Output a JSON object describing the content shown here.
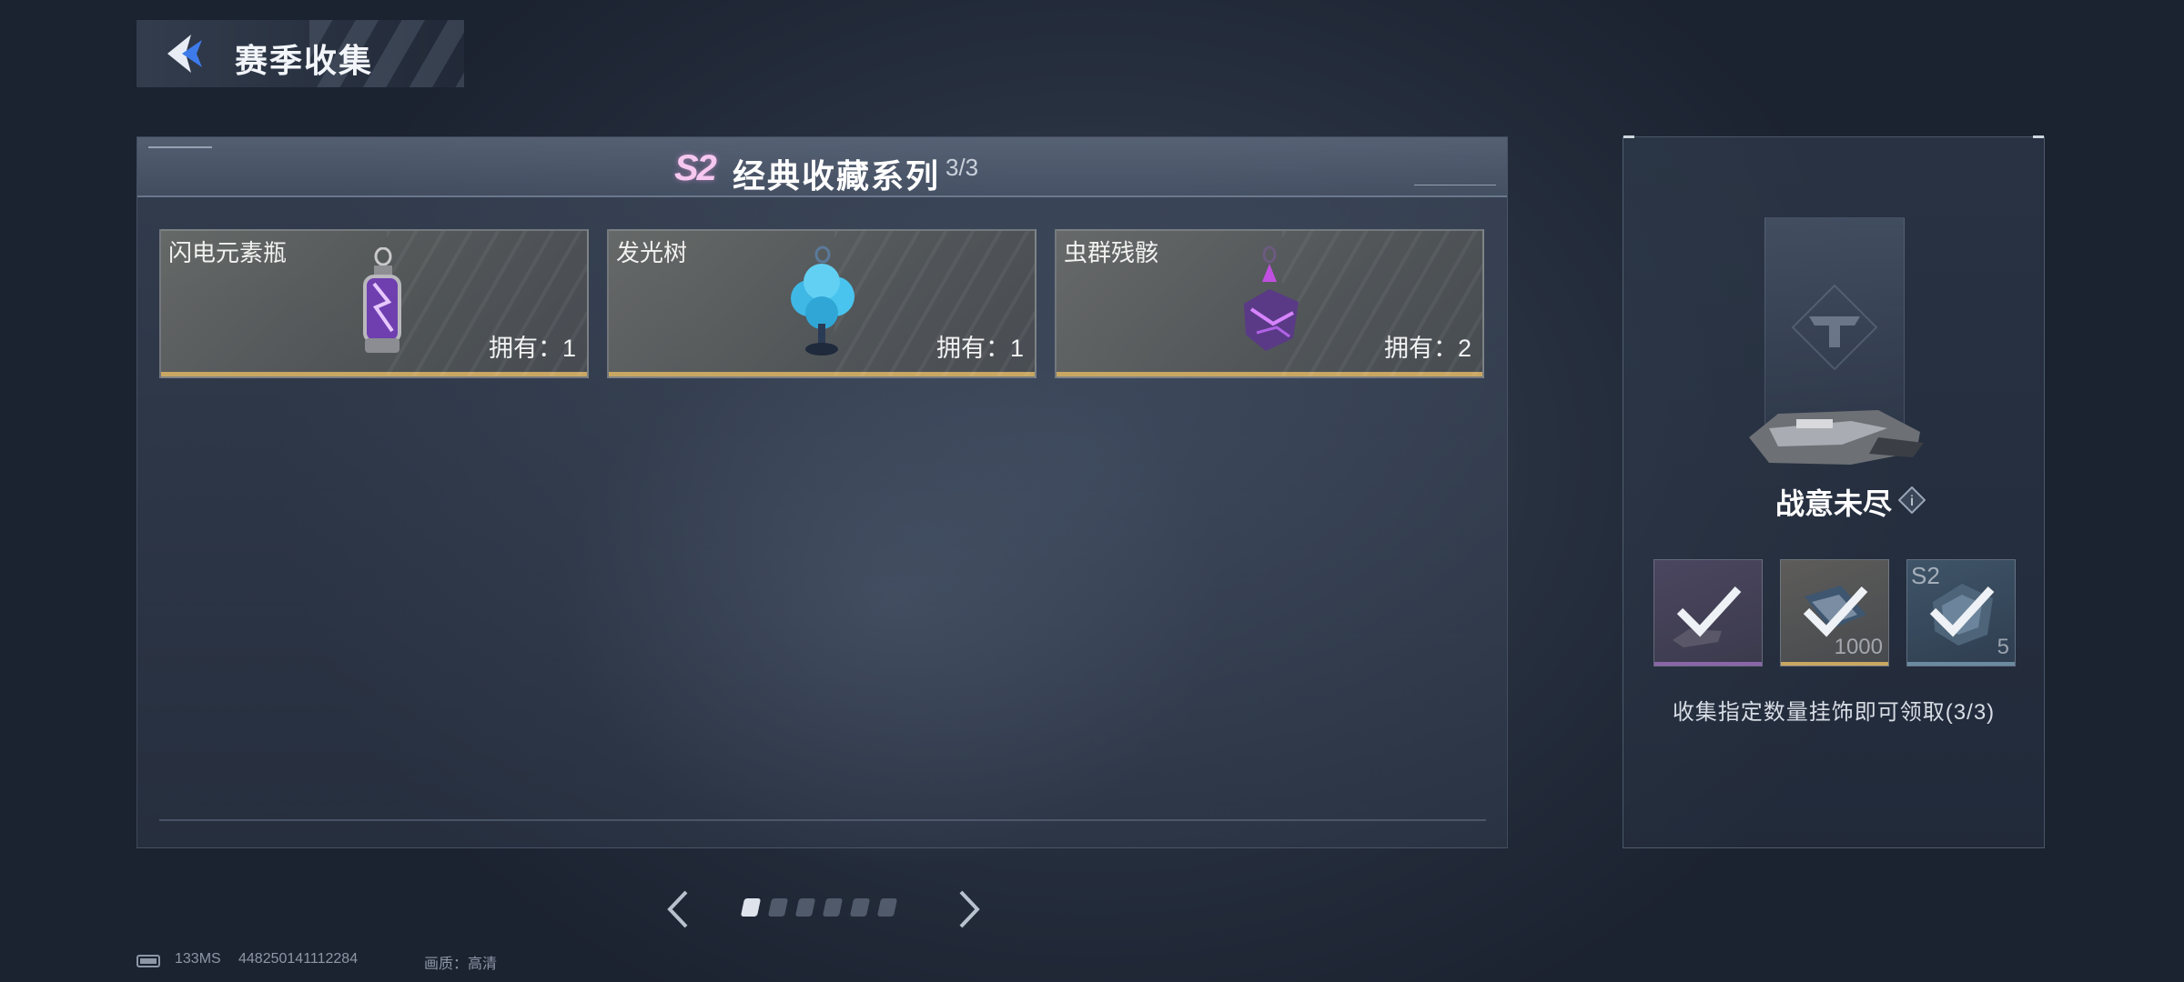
{
  "header": {
    "title": "赛季收集"
  },
  "series": {
    "badge": "S2",
    "title": "经典收藏系列",
    "count": "3/3"
  },
  "cards": [
    {
      "name": "闪电元素瓶",
      "owned": "拥有：1",
      "icon": "lightning-bottle-icon"
    },
    {
      "name": "发光树",
      "owned": "拥有：1",
      "icon": "glowing-tree-icon"
    },
    {
      "name": "虫群残骸",
      "owned": "拥有：2",
      "icon": "swarm-remains-icon"
    }
  ],
  "pagination": {
    "total": 6,
    "current": 1
  },
  "reward": {
    "title": "战意未尽",
    "info_label": "i",
    "slots": [
      {
        "icon": "weapon-skin-icon",
        "qty": "",
        "tag": "",
        "claimed": true,
        "bar_color": "#8a66a8"
      },
      {
        "icon": "card-item-icon",
        "qty": "1000",
        "tag": "",
        "claimed": true,
        "bar_color": "#c9a763"
      },
      {
        "icon": "s2-pack-icon",
        "qty": "5",
        "tag": "S2",
        "claimed": true,
        "bar_color": "#6b8aa0"
      }
    ],
    "description": "收集指定数量挂饰即可领取(3/3)"
  },
  "status": {
    "ping": "133MS",
    "uid": "448250141112284",
    "quality": "画质：高清"
  },
  "colors": {
    "accent_gold": "#c9a763",
    "season_pink": "#f6c7ef"
  }
}
